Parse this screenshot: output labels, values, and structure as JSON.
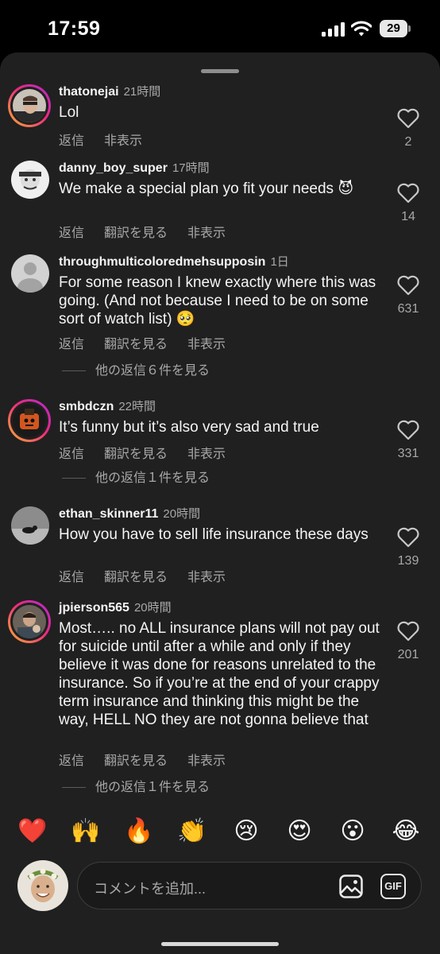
{
  "status_bar": {
    "time": "17:59",
    "battery": "29"
  },
  "comments": [
    {
      "username": "thatonejai",
      "time": "21時間",
      "text": "Lol",
      "actions": [
        "返信",
        "非表示"
      ],
      "likes": "2"
    },
    {
      "username": "danny_boy_super",
      "time": "17時間",
      "text": "We make a special plan yo fit your needs 😈",
      "actions": [
        "返信",
        "翻訳を見る",
        "非表示"
      ],
      "likes": "14"
    },
    {
      "username": "throughmulticoloredmehsupposin",
      "time": "1日",
      "text": "For some reason I knew exactly where this was going. (And not because I need to be on some sort of watch list) 🥺",
      "actions": [
        "返信",
        "翻訳を見る",
        "非表示"
      ],
      "likes": "631",
      "replies": "他の返信６件を見る"
    },
    {
      "username": "smbdczn",
      "time": "22時間",
      "text": "It’s funny but it’s also very sad and true",
      "actions": [
        "返信",
        "翻訳を見る",
        "非表示"
      ],
      "likes": "331",
      "replies": "他の返信１件を見る"
    },
    {
      "username": "ethan_skinner11",
      "time": "20時間",
      "text": "How you have to sell life insurance these days",
      "actions": [
        "返信",
        "翻訳を見る",
        "非表示"
      ],
      "likes": "139"
    },
    {
      "username": "jpierson565",
      "time": "20時間",
      "text": "Most….. no ALL insurance plans will not pay out for suicide until after a while and only if they believe it was done for reasons unrelated to the insurance. So if you’re at the end of your crappy term insurance and thinking this might be the way, HELL NO they are not gonna believe that",
      "actions": [
        "返信",
        "翻訳を見る",
        "非表示"
      ],
      "likes": "201",
      "replies": "他の返信１件を見る"
    }
  ],
  "emoji_bar": [
    "❤️",
    "🙌",
    "🔥",
    "👏",
    "😢",
    "😍",
    "😮",
    "😂"
  ],
  "composer": {
    "placeholder": "コメントを追加...",
    "gif_label": "GIF"
  },
  "colors": {
    "sheet": "#202020",
    "secondary_text": "#a8a8a8",
    "story_ring": "#ee2a7b"
  }
}
